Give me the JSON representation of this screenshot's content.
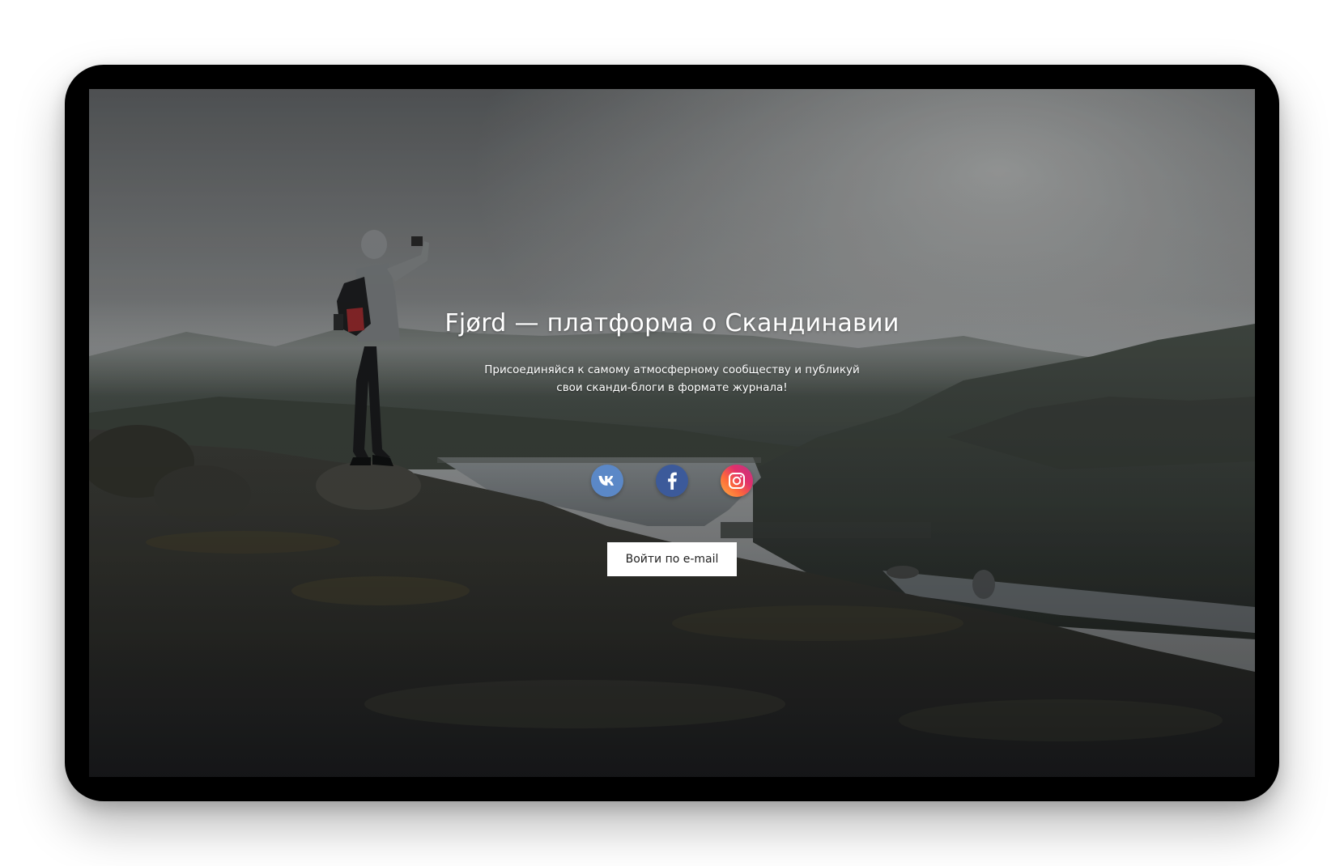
{
  "hero": {
    "title": "Fjørd — платформа о Скандинавии",
    "subtitle_line1": "Присоединяйся к самому атмосферному сообществу и публикуй",
    "subtitle_line2": "свои сканди-блоги в формате журнала!"
  },
  "socials": [
    {
      "icon": "vk-icon",
      "color": "#5b88c7"
    },
    {
      "icon": "facebook-icon",
      "color": "#3c5a9a"
    },
    {
      "icon": "instagram-icon",
      "color": "#e1306c"
    }
  ],
  "login_button": {
    "label": "Войти по e-mail"
  }
}
